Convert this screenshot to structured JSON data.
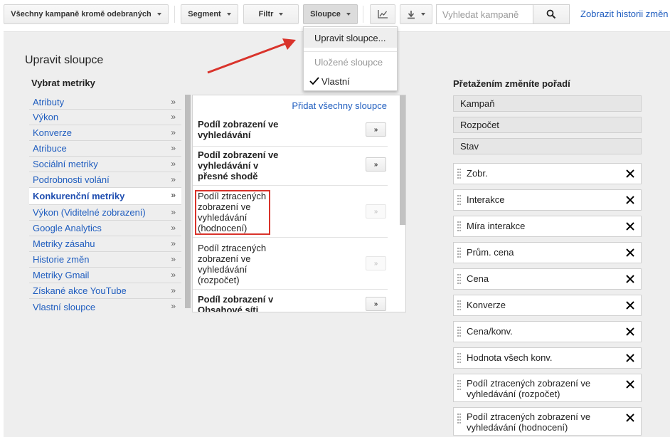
{
  "toolbar": {
    "filter_dropdown": "Všechny kampaně kromě odebraných",
    "segment": "Segment",
    "filter": "Filtr",
    "columns": "Sloupce",
    "search_placeholder": "Vyhledat kampaně",
    "history_link": "Zobrazit historii změn"
  },
  "columns_menu": {
    "edit_columns": "Upravit sloupce...",
    "saved_columns": "Uložené sloupce",
    "custom": "Vlastní"
  },
  "panel": {
    "title": "Upravit sloupce",
    "select_metrics": "Vybrat metriky",
    "reorder_hint": "Přetažením změníte pořadí"
  },
  "categories": [
    {
      "label": "Atributy",
      "arrow": "»"
    },
    {
      "label": "Výkon",
      "arrow": "»"
    },
    {
      "label": "Konverze",
      "arrow": "»"
    },
    {
      "label": "Atribuce",
      "arrow": "»"
    },
    {
      "label": "Sociální metriky",
      "arrow": "»"
    },
    {
      "label": "Podrobnosti volání",
      "arrow": "»"
    },
    {
      "label": "Konkurenční metriky",
      "arrow": "»"
    },
    {
      "label": "Výkon (Viditelné zobrazení)",
      "arrow": "»"
    },
    {
      "label": "Google Analytics",
      "arrow": "»"
    },
    {
      "label": "Metriky zásahu",
      "arrow": "»"
    },
    {
      "label": "Historie změn",
      "arrow": "»"
    },
    {
      "label": "Metriky Gmail",
      "arrow": "»"
    },
    {
      "label": "Získané akce YouTube",
      "arrow": "»"
    },
    {
      "label": "Vlastní sloupce",
      "arrow": "»"
    }
  ],
  "selected_category": "Konkurenční metriky",
  "metrics": {
    "add_all": "Přidat všechny sloupce",
    "items": [
      {
        "lines": [
          "Podíl zobrazení ve",
          "vyhledávání"
        ],
        "bold": true,
        "button": "»",
        "enabled": true
      },
      {
        "lines": [
          "Podíl zobrazení ve",
          "vyhledávání v",
          "přesné shodě"
        ],
        "bold": true,
        "button": "»",
        "enabled": true
      },
      {
        "lines": [
          "Podíl ztracených",
          "zobrazení ve",
          "vyhledávání",
          "(hodnocení)"
        ],
        "bold": false,
        "button": "»",
        "enabled": false
      },
      {
        "lines": [
          "Podíl ztracených",
          "zobrazení ve",
          "vyhledávání",
          "(rozpočet)"
        ],
        "bold": false,
        "button": "»",
        "enabled": false
      },
      {
        "lines": [
          "Podíl zobrazení v",
          "Obsahové síti"
        ],
        "bold": true,
        "button": "»",
        "enabled": true
      }
    ]
  },
  "fixed_columns": [
    "Kampaň",
    "Rozpočet",
    "Stav"
  ],
  "selected_columns": [
    [
      "Zobr."
    ],
    [
      "Interakce"
    ],
    [
      "Míra interakce"
    ],
    [
      "Prům. cena"
    ],
    [
      "Cena"
    ],
    [
      "Konverze"
    ],
    [
      "Cena/konv."
    ],
    [
      "Hodnota všech konv."
    ],
    [
      "Podíl ztracených zobrazení ve",
      "vyhledávání (rozpočet)"
    ],
    [
      "Podíl ztracených zobrazení ve",
      "vyhledávání (hodnocení)"
    ]
  ],
  "colors": {
    "link": "#1f5dbf",
    "annotation_red": "#d9332b",
    "panel_bg": "#eeeeee"
  }
}
